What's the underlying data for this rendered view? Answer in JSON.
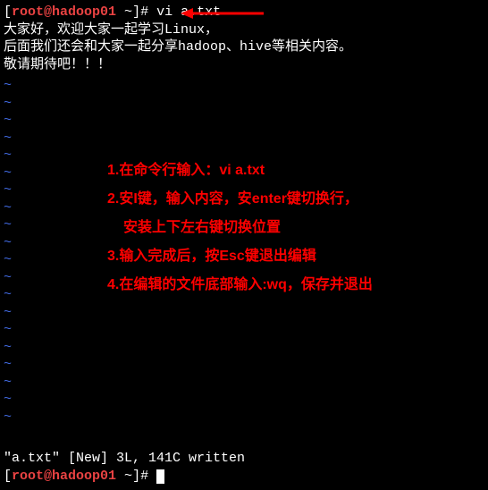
{
  "prompt1": {
    "open": "[",
    "user": "root@hadoop01",
    "path": " ~",
    "close": "]# ",
    "command": "vi a.txt"
  },
  "content": {
    "line1": "大家好，欢迎大家一起学习Linux，",
    "line2": "后面我们还会和大家一起分享hadoop、hive等相关内容。",
    "line3": "敬请期待吧！！！"
  },
  "tilde_char": "~",
  "tilde_count": 20,
  "annotations": {
    "l1": "1.在命令行输入：vi a.txt",
    "l2": "2.安I键，输入内容，安enter键切换行，",
    "l3": "安装上下左右键切换位置",
    "l4": "3.输入完成后，按Esc键退出编辑",
    "l5": "4.在编辑的文件底部输入:wq，保存并退出"
  },
  "status": "\"a.txt\" [New] 3L, 141C written",
  "prompt2": {
    "open": "[",
    "user": "root@hadoop01",
    "path": " ~",
    "close": "]# "
  },
  "arrow_color": "#ff0000"
}
